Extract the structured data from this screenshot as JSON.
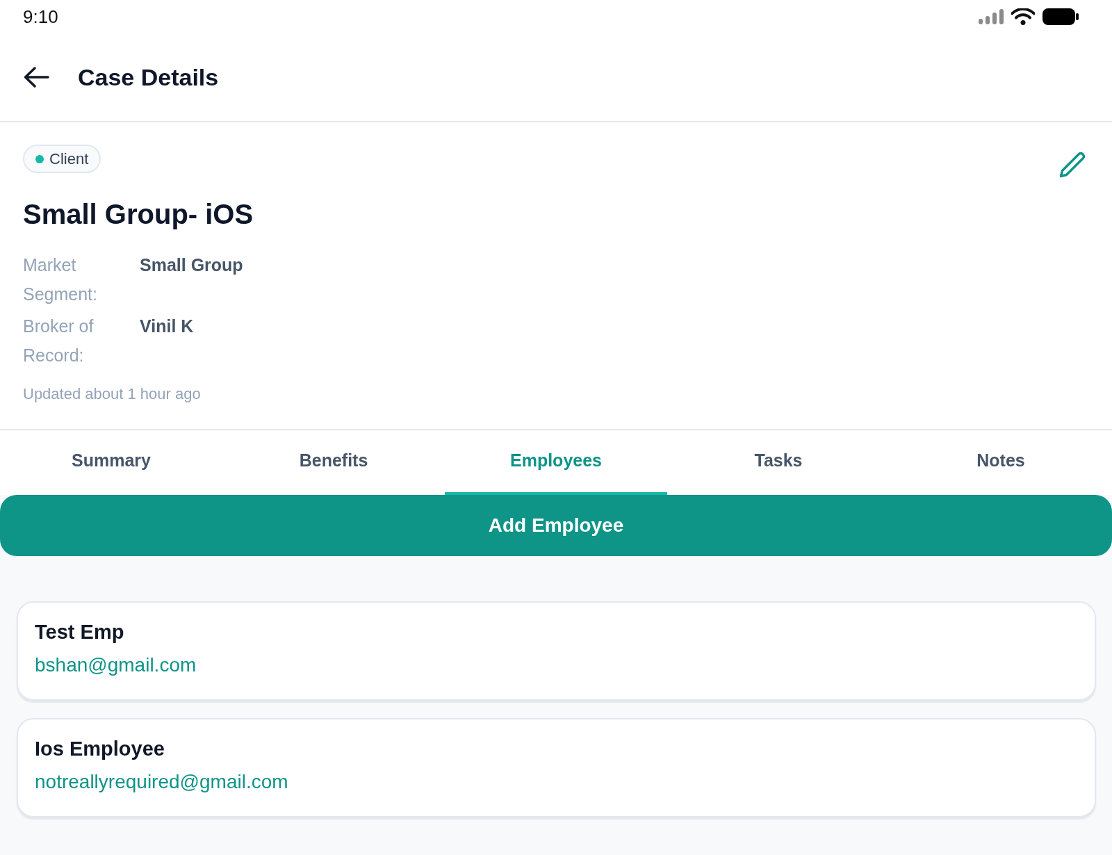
{
  "status_bar": {
    "time": "9:10"
  },
  "header": {
    "title": "Case Details"
  },
  "case": {
    "badge": {
      "label": "Client"
    },
    "title": "Small Group- iOS",
    "fields": [
      {
        "label": "Market Segment:",
        "value": "Small Group"
      },
      {
        "label": "Broker of Record:",
        "value": "Vinil K"
      }
    ],
    "updated": "Updated about 1 hour ago"
  },
  "tabs": [
    {
      "label": "Summary",
      "selected": false
    },
    {
      "label": "Benefits",
      "selected": false
    },
    {
      "label": "Employees",
      "selected": true
    },
    {
      "label": "Tasks",
      "selected": false
    },
    {
      "label": "Notes",
      "selected": false
    }
  ],
  "add_button": {
    "label": "Add Employee"
  },
  "employees": [
    {
      "name": "Test Emp",
      "email": "bshan@gmail.com"
    },
    {
      "name": "Ios Employee",
      "email": "notreallyrequired@gmail.com"
    }
  ]
}
